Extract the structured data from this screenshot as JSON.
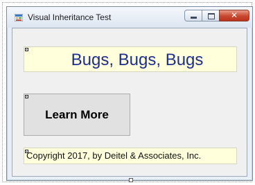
{
  "window": {
    "title": "Visual Inheritance Test",
    "icon": "winforms-app-icon",
    "controls": {
      "minimize": "minimize-icon",
      "maximize": "maximize-icon",
      "close_glyph": "✕"
    }
  },
  "form": {
    "heading_label": "Bugs, Bugs, Bugs",
    "button_label": "Learn More",
    "copyright_label": "Copyright 2017, by Deitel & Associates, Inc."
  },
  "colors": {
    "label_background": "#ffffdc",
    "heading_text": "#1e2f8a",
    "close_button": "#c9472e"
  }
}
